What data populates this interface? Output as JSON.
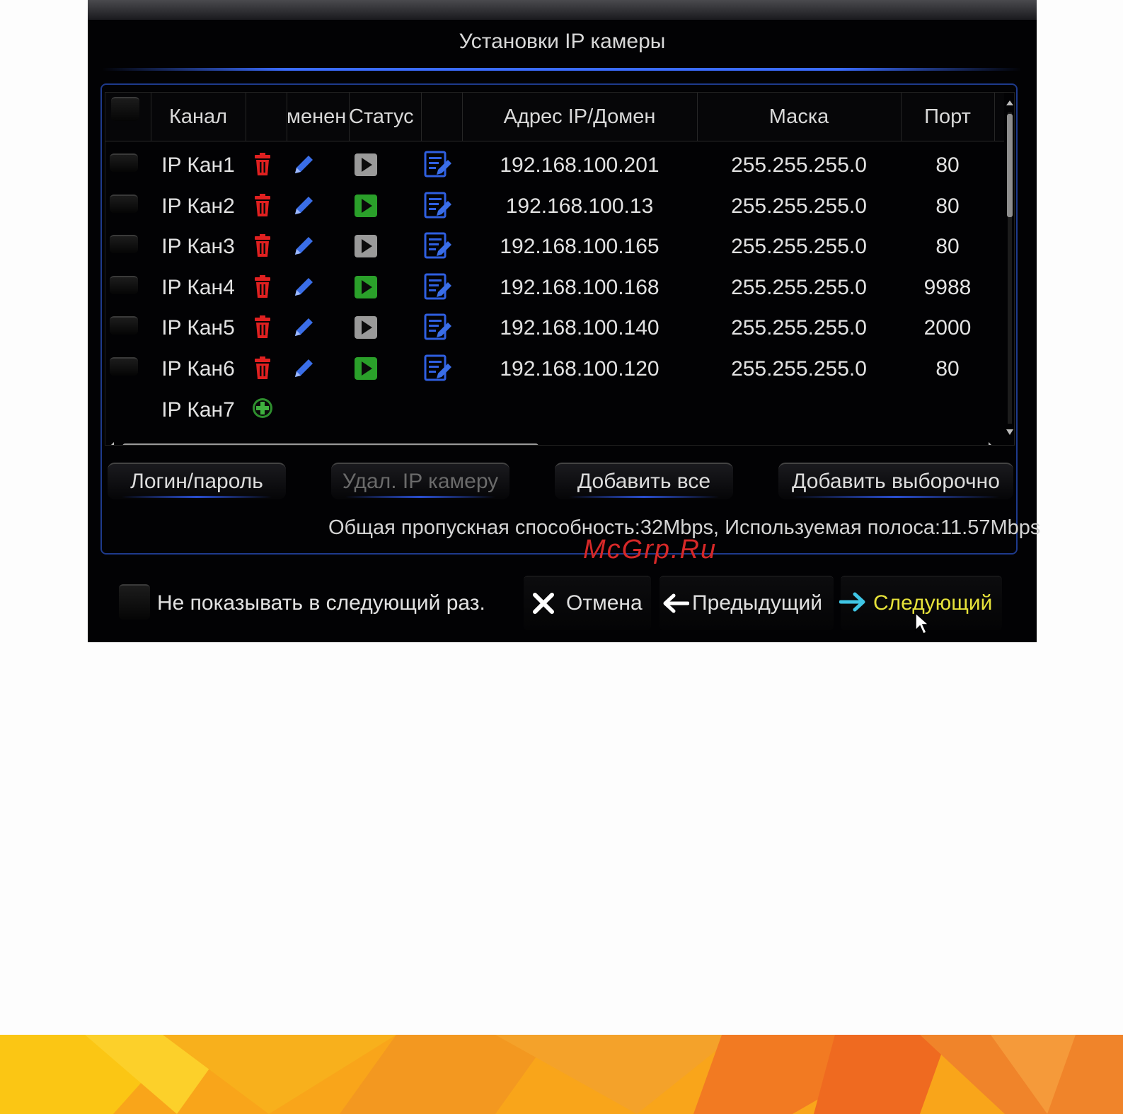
{
  "dialog": {
    "title": "Установки IP камеры",
    "columns": {
      "channel": "Канал",
      "manage": "менен",
      "status": "Статус",
      "ip": "Адрес IP/Домен",
      "mask": "Маска",
      "port": "Порт"
    },
    "rows": [
      {
        "channel": "IP Кан1",
        "ip": "192.168.100.201",
        "mask": "255.255.255.0",
        "port": "80",
        "status": "gray"
      },
      {
        "channel": "IP Кан2",
        "ip": "192.168.100.13",
        "mask": "255.255.255.0",
        "port": "80",
        "status": "green"
      },
      {
        "channel": "IP Кан3",
        "ip": "192.168.100.165",
        "mask": "255.255.255.0",
        "port": "80",
        "status": "gray"
      },
      {
        "channel": "IP Кан4",
        "ip": "192.168.100.168",
        "mask": "255.255.255.0",
        "port": "9988",
        "status": "green"
      },
      {
        "channel": "IP Кан5",
        "ip": "192.168.100.140",
        "mask": "255.255.255.0",
        "port": "2000",
        "status": "gray"
      },
      {
        "channel": "IP Кан6",
        "ip": "192.168.100.120",
        "mask": "255.255.255.0",
        "port": "80",
        "status": "green"
      }
    ],
    "add_row": {
      "channel": "IP Кан7"
    },
    "buttons": {
      "login": "Логин/пароль",
      "delete": "Удал. IP камеру",
      "add_all": "Добавить все",
      "add_selected": "Добавить выборочно"
    },
    "bandwidth": "Общая пропускная способность:32Mbps, Используемая полоса:11.57Mbps",
    "dont_show": "Не показывать в следующий раз.",
    "cancel": "Отмена",
    "prev": "Предыдущий",
    "next": "Следующий"
  },
  "watermark": "McGrp.Ru",
  "icons": {
    "delete": "trash-icon",
    "edit": "pencil-icon",
    "status": "play-icon",
    "config": "settings-doc-icon",
    "add": "add-circle-icon"
  },
  "colors": {
    "delete": "#e02020",
    "edit": "#3a6ee8",
    "status_online": "#2aa02a",
    "status_offline": "#9a9a9a",
    "next_text": "#e6e23a",
    "next_arrow": "#3fc6e6",
    "accent_line": "#3b6cff"
  }
}
